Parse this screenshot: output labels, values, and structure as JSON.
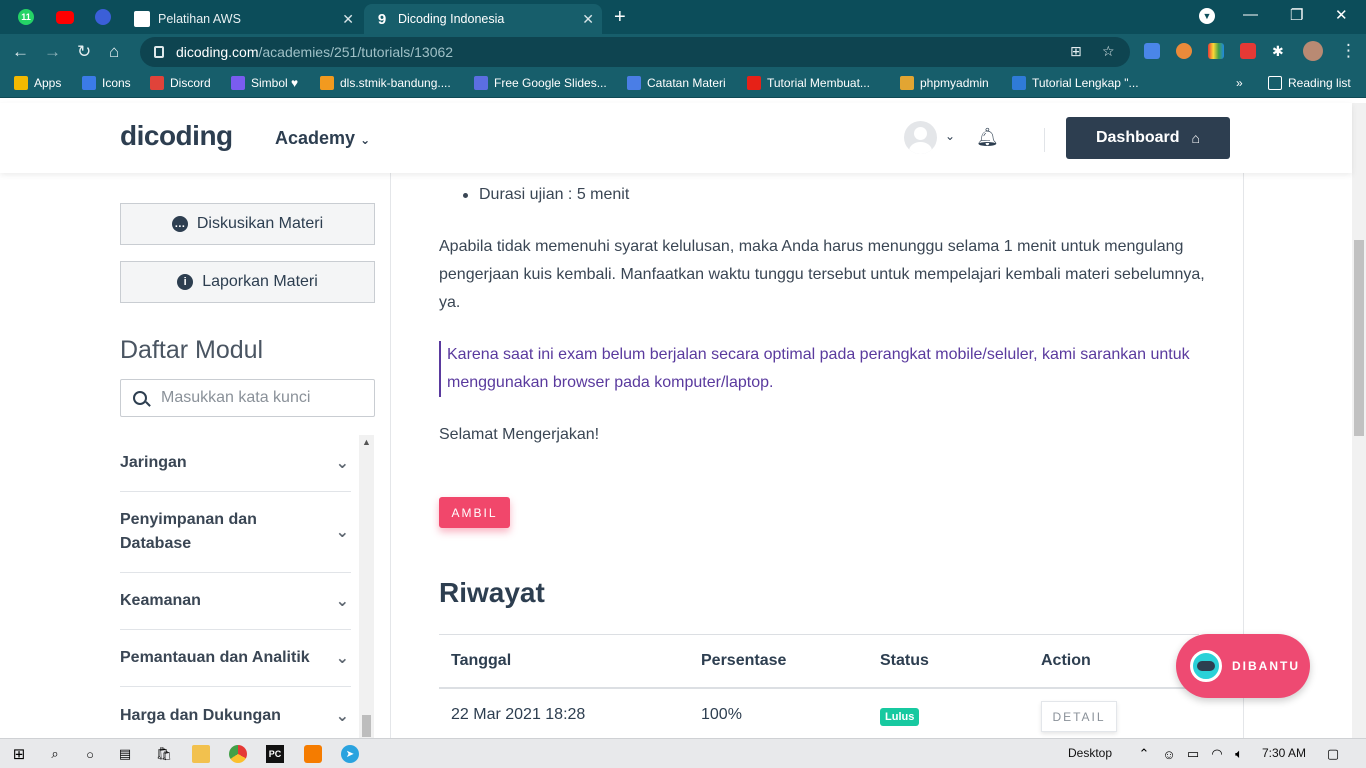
{
  "browser": {
    "tabs": [
      {
        "title": "Pelatihan AWS",
        "icon": "slides-icon"
      },
      {
        "title": "Dicoding Indonesia",
        "icon": "dicoding-icon",
        "active": true
      }
    ],
    "pinned_badge": "11",
    "url_host": "dicoding.com",
    "url_path": "/academies/251/tutorials/13062",
    "bookmarks": [
      {
        "label": "Apps",
        "color": "#f2b900"
      },
      {
        "label": "Icons",
        "color": "#3b7be8"
      },
      {
        "label": "Discord",
        "color": "#e0433a"
      },
      {
        "label": "Simbol ♥",
        "color": "#7a5cf0"
      },
      {
        "label": "dls.stmik-bandung....",
        "color": "#f29a1f"
      },
      {
        "label": "Free Google Slides...",
        "color": "#5b6ee1"
      },
      {
        "label": "Catatan Materi",
        "color": "#4a7ee6"
      },
      {
        "label": "Tutorial Membuat...",
        "color": "#e62117"
      },
      {
        "label": "phpmyadmin",
        "color": "#e2a532"
      },
      {
        "label": "Tutorial Lengkap \"...",
        "color": "#2f7bd8"
      }
    ],
    "more_bookmarks": "»",
    "reading_list": "Reading list"
  },
  "header": {
    "logo": "dicoding",
    "nav_academy": "Academy",
    "dashboard_label": "Dashboard"
  },
  "sidebar": {
    "discuss_label": "Diskusikan Materi",
    "report_label": "Laporkan Materi",
    "module_heading": "Daftar Modul",
    "search_placeholder": "Masukkan kata kunci",
    "modules": [
      {
        "label": "Jaringan"
      },
      {
        "label": "Penyimpanan dan Database"
      },
      {
        "label": "Keamanan"
      },
      {
        "label": "Pemantauan dan Analitik"
      },
      {
        "label": "Harga dan Dukungan"
      }
    ]
  },
  "content": {
    "bullet_duration": "Durasi ujian : 5 menit",
    "para_retry": "Apabila tidak memenuhi syarat kelulusan, maka Anda harus menunggu selama 1 menit untuk mengulang pengerjaan kuis kembali. Manfaatkan waktu tunggu tersebut untuk mempelajari kembali materi sebelumnya, ya.",
    "note": "Karena saat ini exam belum berjalan secara optimal pada perangkat mobile/seluler, kami sarankan untuk menggunakan browser pada komputer/laptop.",
    "greeting": "Selamat Mengerjakan!",
    "take_button": "AMBIL",
    "history_heading": "Riwayat",
    "table_headers": [
      "Tanggal",
      "Persentase",
      "Status",
      "Action"
    ],
    "rows": [
      {
        "date": "22 Mar 2021 18:28",
        "percent": "100%",
        "status": "Lulus",
        "action": "DETAIL"
      }
    ]
  },
  "widget": {
    "label": "DIBANTU"
  },
  "taskbar": {
    "desktop_label": "Desktop",
    "time": "7:30 AM"
  },
  "colors": {
    "browser_frame": "#175e6b",
    "primary_dark": "#2d3e50",
    "accent_pink": "#f1476b",
    "note_purple": "#5a3a9e",
    "status_green": "#17c9a0"
  }
}
